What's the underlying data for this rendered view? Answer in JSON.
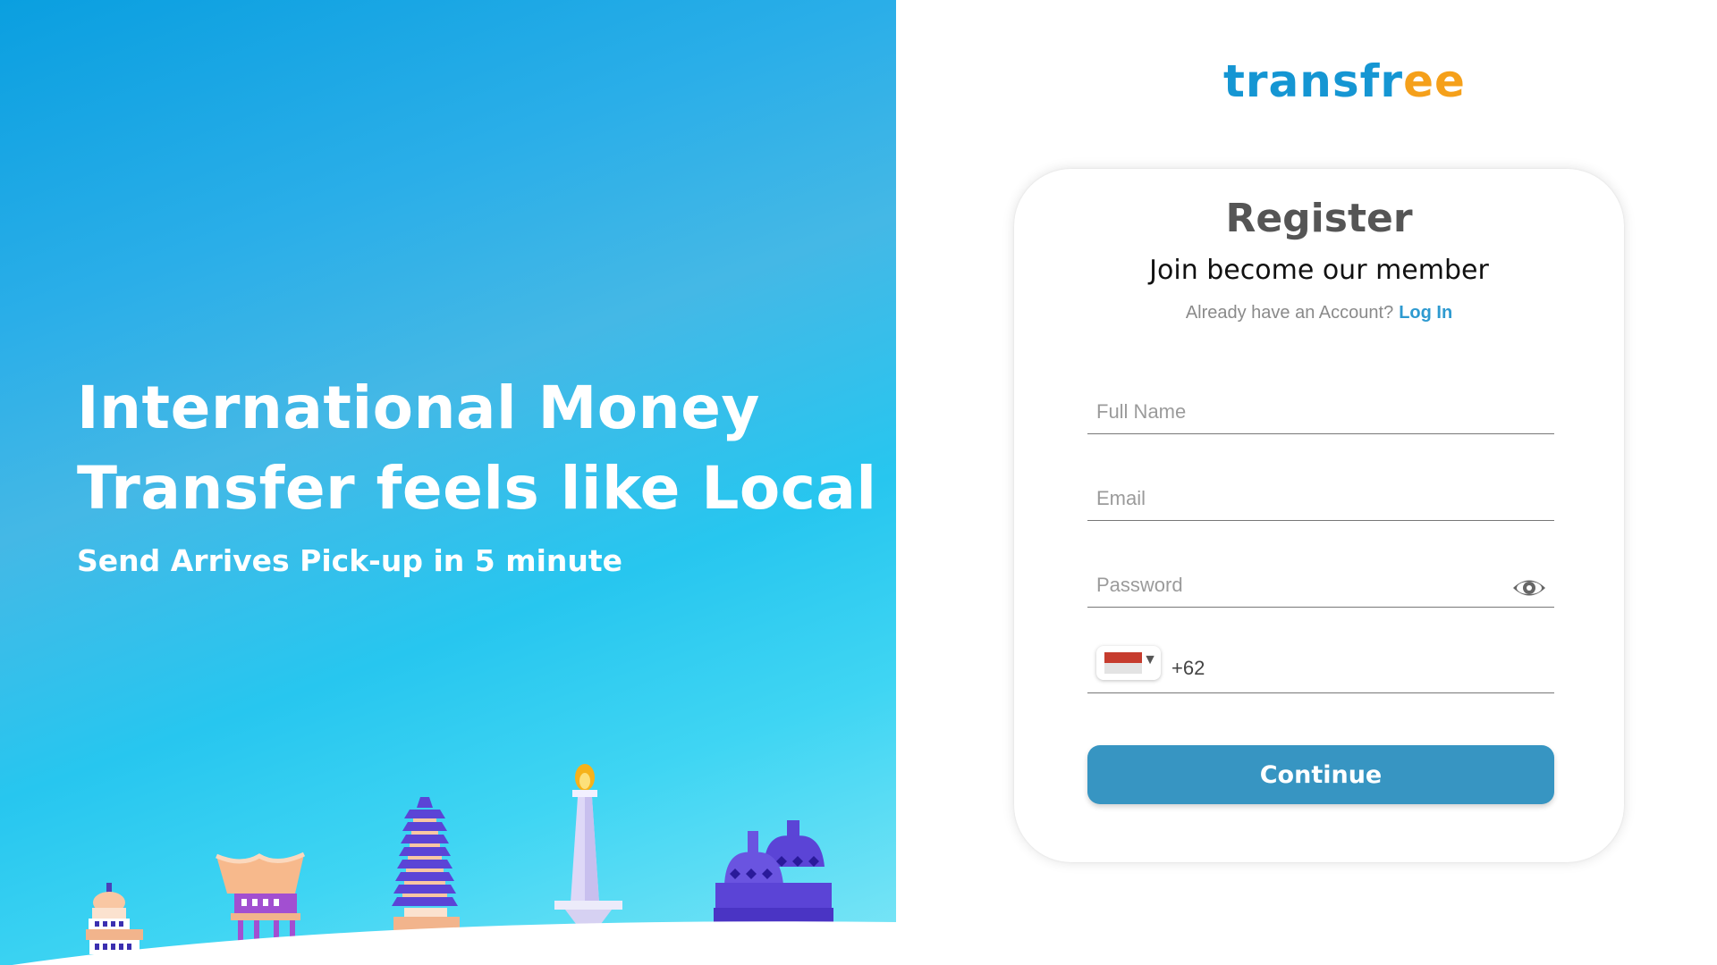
{
  "hero": {
    "title_line1": "International Money",
    "title_line2": "Transfer feels like Local",
    "subtitle": "Send Arrives Pick-up in 5 minute"
  },
  "logo": {
    "part1": "transfr",
    "part2": "ee"
  },
  "register": {
    "title": "Register",
    "subtitle": "Join become our member",
    "have_account": "Already have an Account?",
    "login_link": "Log In",
    "fields": {
      "full_name_placeholder": "Full Name",
      "email_placeholder": "Email",
      "password_placeholder": "Password",
      "phone_code": "+62"
    },
    "continue_label": "Continue"
  },
  "colors": {
    "brand_blue": "#1596d3",
    "brand_orange": "#f5a01a",
    "button": "#3795c2",
    "link": "#2e9ad0"
  },
  "icons": {
    "password_toggle": "eye-icon",
    "country_flag": "indonesia-flag-icon"
  }
}
